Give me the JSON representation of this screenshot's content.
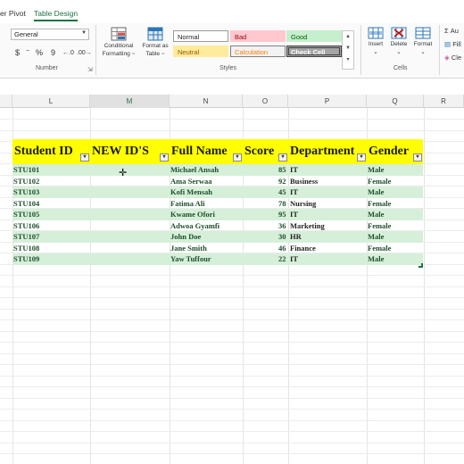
{
  "ribbon_tabs": [
    {
      "label": "er Pivot",
      "active": false
    },
    {
      "label": "Table Design",
      "active": true
    }
  ],
  "number_group": {
    "format_value": "General",
    "currency_symbol": "$",
    "currency_caret": "~",
    "percent_symbol": "%",
    "comma_symbol": "9",
    "label": "Number"
  },
  "styles_group": {
    "conditional_formatting": {
      "line1": "Conditional",
      "line2": "Formatting ~"
    },
    "format_as_table": {
      "line1": "Format as",
      "line2": "Table ~"
    },
    "cells": [
      {
        "label": "Normal",
        "bg": "#ffffff",
        "color": "#222222",
        "border": "#9a9a9a"
      },
      {
        "label": "Bad",
        "bg": "#ffc7ce",
        "color": "#9c0006",
        "border": "#ffc7ce"
      },
      {
        "label": "Good",
        "bg": "#c6efce",
        "color": "#006100",
        "border": "#c6efce"
      },
      {
        "label": "Neutral",
        "bg": "#ffeb9c",
        "color": "#9c5700",
        "border": "#ffeb9c"
      },
      {
        "label": "Calculation",
        "bg": "#f2f2f2",
        "color": "#fa7d00",
        "border": "#7f7f7f"
      },
      {
        "label": "Check Cell",
        "bg": "#a5a5a5",
        "color": "#ffffff",
        "border": "#3f3f3f"
      }
    ],
    "label": "Styles"
  },
  "cells_group": {
    "insert": "Insert",
    "delete": "Delete",
    "format": "Format",
    "label": "Cells"
  },
  "editing_group": {
    "autosum": "Au",
    "fill": "Fill",
    "clear": "Cle"
  },
  "columns": [
    {
      "letter": "L",
      "selected": false
    },
    {
      "letter": "M",
      "selected": true
    },
    {
      "letter": "N",
      "selected": false
    },
    {
      "letter": "O",
      "selected": false
    },
    {
      "letter": "P",
      "selected": false
    },
    {
      "letter": "Q",
      "selected": false
    },
    {
      "letter": "R",
      "selected": false
    }
  ],
  "table": {
    "headers": [
      "Student ID",
      "NEW ID'S",
      "Full Name",
      "Score",
      "Department",
      "Gender"
    ],
    "rows": [
      {
        "id": "STU101",
        "new_id": "",
        "name": "Michael Ansah",
        "score": "85",
        "dept": "IT",
        "gender": "Male"
      },
      {
        "id": "STU102",
        "new_id": "",
        "name": "Ama Serwaa",
        "score": "92",
        "dept": "Business",
        "gender": "Female"
      },
      {
        "id": "STU103",
        "new_id": "",
        "name": "Kofi Mensah",
        "score": "45",
        "dept": "IT",
        "gender": "Male"
      },
      {
        "id": "STU104",
        "new_id": "",
        "name": "Fatima Ali",
        "score": "78",
        "dept": "Nursing",
        "gender": "Female"
      },
      {
        "id": "STU105",
        "new_id": "",
        "name": "Kwame Ofori",
        "score": "95",
        "dept": "IT",
        "gender": "Male"
      },
      {
        "id": "STU106",
        "new_id": "",
        "name": "Adwoa Gyamfi",
        "score": "36",
        "dept": "Marketing",
        "gender": "Female"
      },
      {
        "id": "STU107",
        "new_id": "",
        "name": "John Doe",
        "score": "30",
        "dept": "HR",
        "gender": "Male"
      },
      {
        "id": "STU108",
        "new_id": "",
        "name": "Jane Smith",
        "score": "46",
        "dept": "Finance",
        "gender": "Female"
      },
      {
        "id": "STU109",
        "new_id": "",
        "name": "Yaw Tuffour",
        "score": "22",
        "dept": "IT",
        "gender": "Male"
      }
    ]
  },
  "colors": {
    "accent": "#1e7145",
    "header_fill": "#ffff00",
    "band_fill": "#d6efd9"
  }
}
